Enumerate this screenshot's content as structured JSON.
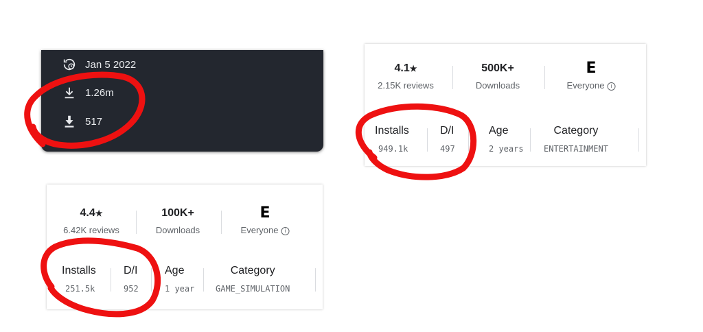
{
  "dark_panel": {
    "date": "Jan 5 2022",
    "downloads": "1.26m",
    "daily": "517",
    "icons": [
      "history-clock-icon",
      "download-icon",
      "download-filled-icon"
    ]
  },
  "card_top": {
    "rating": "4.1",
    "reviews": "2.15K reviews",
    "downloads": "500K+",
    "downloads_label": "Downloads",
    "content_rating": "Everyone",
    "metrics": [
      {
        "label": "Installs",
        "value": "949.1k"
      },
      {
        "label": "D/I",
        "value": "497"
      },
      {
        "label": "Age",
        "value": "2 years"
      },
      {
        "label": "Category",
        "value": "ENTERTAINMENT"
      }
    ]
  },
  "card_bottom": {
    "rating": "4.4",
    "reviews": "6.42K reviews",
    "downloads": "100K+",
    "downloads_label": "Downloads",
    "content_rating": "Everyone",
    "metrics": [
      {
        "label": "Installs",
        "value": "251.5k"
      },
      {
        "label": "D/I",
        "value": "952"
      },
      {
        "label": "Age",
        "value": "1 year"
      },
      {
        "label": "Category",
        "value": "GAME_SIMULATION"
      }
    ]
  },
  "colors": {
    "annotation": "#ee1111",
    "dark_bg": "#23272f"
  }
}
